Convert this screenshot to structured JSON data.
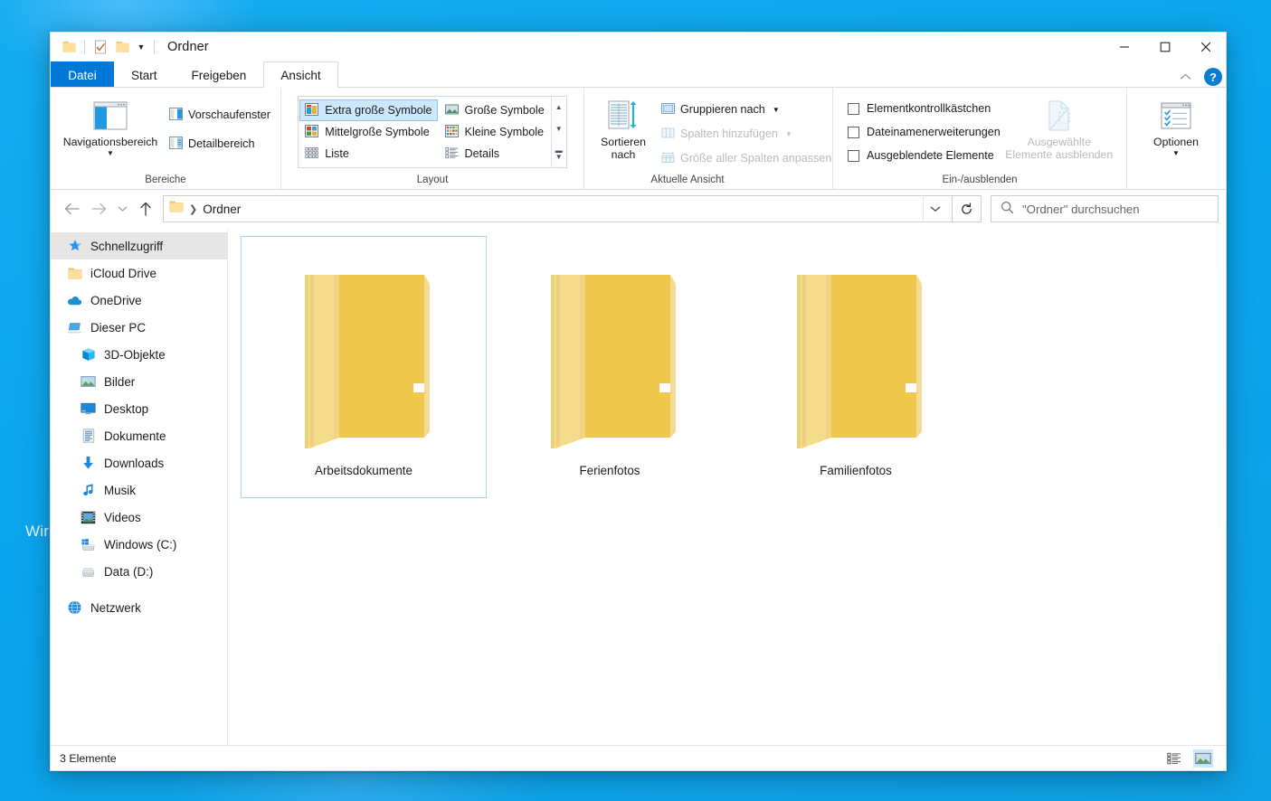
{
  "desktop": {
    "watermark": "Wir",
    "background_color": "#03a9f4"
  },
  "window": {
    "title": "Ordner",
    "quick_access": [
      {
        "name": "folder-icon",
        "label": "Ordner"
      },
      {
        "name": "properties-icon",
        "label": "Eigenschaften"
      },
      {
        "name": "new-folder-icon",
        "label": "Neuer Ordner"
      }
    ],
    "qat_dropdown_label": "Schnellzugriffsleiste anpassen",
    "controls": {
      "minimize": "Minimieren",
      "maximize": "Maximieren",
      "close": "Schließen"
    },
    "collapse_ribbon": "Menüband minimieren",
    "help": "?"
  },
  "tabs": [
    {
      "label": "Datei",
      "kind": "file",
      "active": false
    },
    {
      "label": "Start",
      "kind": "normal",
      "active": false
    },
    {
      "label": "Freigeben",
      "kind": "normal",
      "active": false
    },
    {
      "label": "Ansicht",
      "kind": "normal",
      "active": true
    }
  ],
  "ribbon": {
    "groups": [
      {
        "name": "bereiche",
        "label": "Bereiche",
        "big_button": {
          "label": "Navigationsbereich",
          "has_caret": true
        },
        "small_buttons": [
          {
            "label": "Vorschaufenster",
            "disabled": false
          },
          {
            "label": "Detailbereich",
            "disabled": false
          }
        ]
      },
      {
        "name": "layout",
        "label": "Layout",
        "items": [
          {
            "label": "Extra große Symbole",
            "selected": true
          },
          {
            "label": "Große Symbole",
            "selected": false
          },
          {
            "label": "Mittelgroße Symbole",
            "selected": false
          },
          {
            "label": "Kleine Symbole",
            "selected": false
          },
          {
            "label": "Liste",
            "selected": false
          },
          {
            "label": "Details",
            "selected": false
          }
        ],
        "scroll": [
          "up",
          "down",
          "more"
        ]
      },
      {
        "name": "aktuelle-ansicht",
        "label": "Aktuelle Ansicht",
        "big_button": {
          "label": "Sortieren nach",
          "has_caret": true
        },
        "small_buttons": [
          {
            "label": "Gruppieren nach",
            "disabled": false,
            "caret": true
          },
          {
            "label": "Spalten hinzufügen",
            "disabled": true,
            "caret": true
          },
          {
            "label": "Größe aller Spalten anpassen",
            "disabled": true,
            "caret": false
          }
        ]
      },
      {
        "name": "ein-ausblenden",
        "label": "Ein-/ausblenden",
        "checkboxes": [
          {
            "label": "Elementkontrollkästchen",
            "checked": false
          },
          {
            "label": "Dateinamenerweiterungen",
            "checked": false
          },
          {
            "label": "Ausgeblendete Elemente",
            "checked": false
          }
        ],
        "big_button": {
          "label": "Ausgewählte Elemente ausblenden",
          "disabled": true
        }
      },
      {
        "name": "optionen",
        "label": "",
        "big_button": {
          "label": "Optionen",
          "has_caret": true
        }
      }
    ]
  },
  "address_bar": {
    "back": "Zurück",
    "forward": "Vorwärts",
    "recent": "Zuletzt besuchte Orte",
    "up": "Eine Ebene nach oben",
    "breadcrumbs": [
      "Ordner"
    ],
    "dropdown": "Vorherige Orte",
    "refresh": "Aktualisieren",
    "search_placeholder": "\"Ordner\" durchsuchen",
    "search_value": ""
  },
  "sidebar": {
    "items": [
      {
        "label": "Schnellzugriff",
        "icon": "pin-star-icon",
        "indent": false,
        "selected": true
      },
      {
        "label": "iCloud Drive",
        "icon": "folder-icon",
        "indent": false,
        "selected": false
      },
      {
        "label": "OneDrive",
        "icon": "cloud-icon",
        "indent": false,
        "selected": false
      },
      {
        "label": "Dieser PC",
        "icon": "pc-icon",
        "indent": false,
        "selected": false
      },
      {
        "label": "3D-Objekte",
        "icon": "cube-icon",
        "indent": true,
        "selected": false
      },
      {
        "label": "Bilder",
        "icon": "picture-icon",
        "indent": true,
        "selected": false
      },
      {
        "label": "Desktop",
        "icon": "desktop-icon",
        "indent": true,
        "selected": false
      },
      {
        "label": "Dokumente",
        "icon": "document-icon",
        "indent": true,
        "selected": false
      },
      {
        "label": "Downloads",
        "icon": "download-arrow-icon",
        "indent": true,
        "selected": false
      },
      {
        "label": "Musik",
        "icon": "music-note-icon",
        "indent": true,
        "selected": false
      },
      {
        "label": "Videos",
        "icon": "film-icon",
        "indent": true,
        "selected": false
      },
      {
        "label": "Windows (C:)",
        "icon": "windows-drive-icon",
        "indent": true,
        "selected": false
      },
      {
        "label": "Data (D:)",
        "icon": "drive-icon",
        "indent": true,
        "selected": false
      },
      {
        "label": "Netzwerk",
        "icon": "network-icon",
        "indent": false,
        "selected": false
      }
    ]
  },
  "content": {
    "files": [
      {
        "name": "Arbeitsdokumente",
        "type": "folder",
        "selected": true
      },
      {
        "name": "Ferienfotos",
        "type": "folder",
        "selected": false
      },
      {
        "name": "Familienfotos",
        "type": "folder",
        "selected": false
      }
    ]
  },
  "status_bar": {
    "item_count": "3 Elemente",
    "view_details_label": "Details anzeigen",
    "view_large_icons_label": "Große Symbole anzeigen"
  },
  "colors": {
    "accent": "#0078d7",
    "folder_yellow": "#f3cc53",
    "selection": "#cce8ff"
  }
}
